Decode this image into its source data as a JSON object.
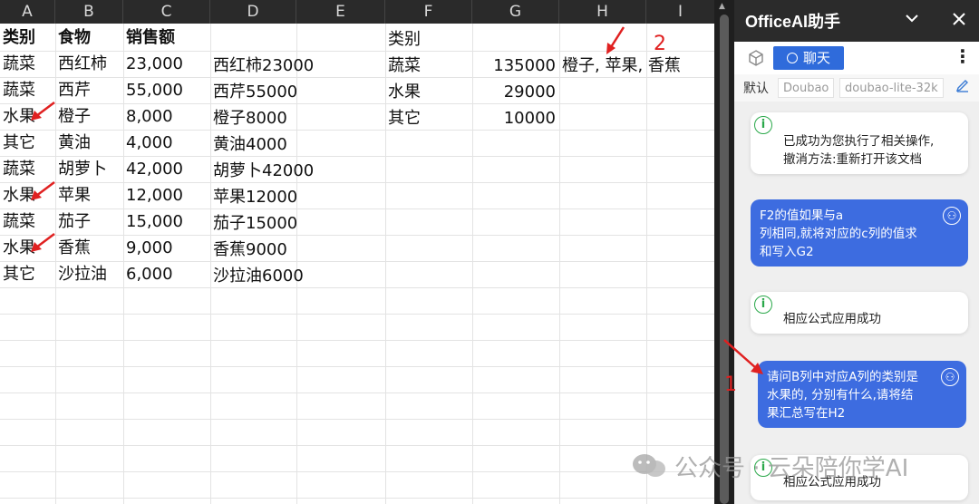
{
  "sheet": {
    "columns": [
      "A",
      "B",
      "C",
      "D",
      "E",
      "F",
      "G",
      "H",
      "I"
    ],
    "block_abc": {
      "header": [
        "类别",
        "食物",
        "销售额"
      ],
      "rows": [
        [
          "蔬菜",
          "西红柿",
          "23,000"
        ],
        [
          "蔬菜",
          "西芹",
          "55,000"
        ],
        [
          "水果",
          "橙子",
          "8,000"
        ],
        [
          "其它",
          "黄油",
          "4,000"
        ],
        [
          "蔬菜",
          "胡萝卜",
          "42,000"
        ],
        [
          "水果",
          "苹果",
          "12,000"
        ],
        [
          "蔬菜",
          "茄子",
          "15,000"
        ],
        [
          "水果",
          "香蕉",
          "9,000"
        ],
        [
          "其它",
          "沙拉油",
          "6,000"
        ]
      ]
    },
    "column_d": [
      "西红柿23000",
      "西芹55000",
      "橙子8000",
      "黄油4000",
      "胡萝卜42000",
      "苹果12000",
      "茄子15000",
      "香蕉9000",
      "沙拉油6000"
    ],
    "block_fgh": {
      "header_f": "类别",
      "rows": [
        {
          "category": "蔬菜",
          "total": "135000",
          "foods": "橙子, 苹果, 香蕉"
        },
        {
          "category": "水果",
          "total": "29000",
          "foods": ""
        },
        {
          "category": "其它",
          "total": "10000",
          "foods": ""
        }
      ]
    },
    "annotation_1": "1",
    "annotation_2": "2",
    "accent_red": "#e02020"
  },
  "watermark": {
    "text": "公众号 · 云朵陪你学AI",
    "icon": "wechat-icon"
  },
  "panel": {
    "title": "OfficeAI助手",
    "chat_tab": "聊天",
    "model_default": "默认",
    "model_provider": "Doubao",
    "model_name": "doubao-lite-32k",
    "accent_blue": "#3d6ce0",
    "messages": [
      {
        "role": "system",
        "text": "已成功为您执行了相关操作,\n撤消方法:重新打开该文档"
      },
      {
        "role": "user",
        "text": "F2的值如果与a\n列相同,就将对应的c列的值求\n和写入G2"
      },
      {
        "role": "system",
        "text": "相应公式应用成功"
      },
      {
        "role": "user",
        "text": "请问B列中对应A列的类别是\n水果的, 分别有什么,请将结\n果汇总写在H2"
      },
      {
        "role": "system",
        "text": "相应公式应用成功"
      }
    ]
  }
}
